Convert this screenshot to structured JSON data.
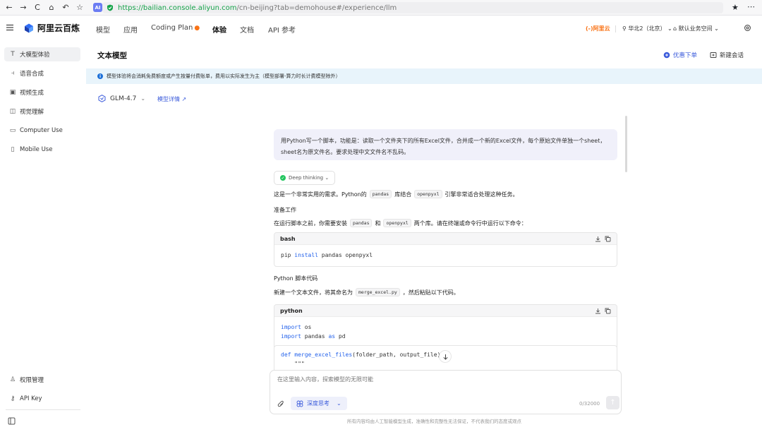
{
  "browser": {
    "url_host": "https://bailian.console.aliyun.com",
    "url_rest": "/cn-beijing?tab=demohouse#/experience/llm",
    "ai_badge": "AI"
  },
  "nav": {
    "logo_text": "阿里云百炼",
    "items": [
      "模型",
      "应用",
      "Coding Plan",
      "体验",
      "文档",
      "API 参考"
    ],
    "brand": "(-)阿里云",
    "region": "华北2（北京）",
    "workspace": "默认业务空间"
  },
  "sidebar": {
    "items": [
      {
        "label": "大模型体验",
        "icon": "text-icon"
      },
      {
        "label": "语音合成",
        "icon": "audio-wave-icon"
      },
      {
        "label": "视频生成",
        "icon": "video-icon"
      },
      {
        "label": "视觉理解",
        "icon": "image-icon"
      },
      {
        "label": "Computer Use",
        "icon": "monitor-icon"
      },
      {
        "label": "Mobile Use",
        "icon": "mobile-icon"
      }
    ],
    "bottom": [
      {
        "label": "权限管理",
        "icon": "user-icon"
      },
      {
        "label": "API Key",
        "icon": "key-icon"
      }
    ]
  },
  "header": {
    "title": "文本模型",
    "discount": "优惠下单",
    "new_chat": "新建会话"
  },
  "notice": "模型体验将会消耗免费额度或产生按量付费账单，费用以实际发生为主（模型部署-算力时长计费模型除外）",
  "model": {
    "name": "GLM-4.7",
    "detail_link": "模型详情 ↗"
  },
  "chat": {
    "user_message": "用Python写一个脚本，功能是：读取一个文件夹下的所有Excel文件，合并成一个新的Excel文件，每个原始文件单独一个sheet，sheet名为原文件名。要求处理中文文件名不乱码。",
    "thinking_label": "Deep thinking",
    "intro": {
      "pre": "这是一个非常实用的需求。Python的",
      "c1": "pandas",
      "mid": "库结合",
      "c2": "openpyxl",
      "post": "引擎非常适合处理这种任务。"
    },
    "prep_heading": "准备工作",
    "prep_text": {
      "pre": "在运行脚本之前，你需要安装",
      "c1": "pandas",
      "mid": "和",
      "c2": "openpyxl",
      "post": "两个库。请在终端或命令行中运行以下命令："
    },
    "bash_lang": "bash",
    "bash_code": {
      "cmd": "pip ",
      "kw": "install",
      "rest": " pandas openpyxl"
    },
    "script_heading": "Python 脚本代码",
    "script_text": {
      "pre": "新建一个文本文件，将其命名为",
      "c1": "merge_excel.py",
      "post": "，然后粘贴以下代码。"
    },
    "python_lang": "python",
    "python_lines": [
      {
        "kw": "import",
        "rest": " os"
      },
      {
        "kw": "import",
        "rest": " pandas ",
        "kw2": "as",
        "rest2": " pd"
      },
      {
        "kw": "",
        "rest": ""
      },
      {
        "kw": "def",
        "fn": " merge_excel_files",
        "rest": "(folder_path, output_file):"
      },
      {
        "kw": "",
        "rest": "    \"\"\""
      }
    ]
  },
  "input": {
    "placeholder": "在这里输入内容，探索模型的无限可能",
    "deep_think": "深度思考",
    "counter": "0/32000"
  },
  "disclaimer": "所有内容均由人工智能模型生成，准确性和完整性无法保证，不代表我们的态度或观点"
}
